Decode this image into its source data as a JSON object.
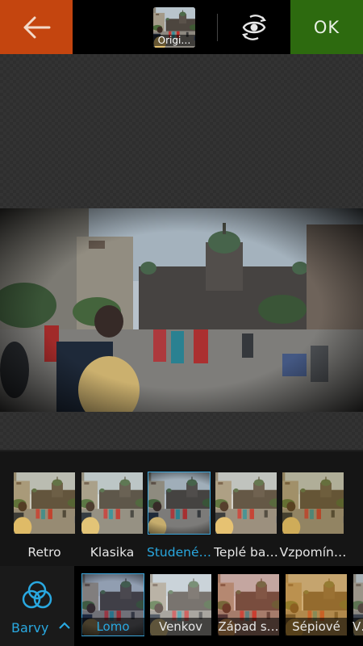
{
  "toolbar": {
    "back_icon": "arrow-left-icon",
    "original_label": "Origi…",
    "compare_icon": "compare-toggle-icon",
    "ok_label": "OK",
    "colors": {
      "back": "#c4450f",
      "ok": "#2d6a0f",
      "accent": "#29a8e0"
    }
  },
  "collapse_icon": "chevron-down-icon",
  "filters": [
    {
      "label": "Retro",
      "selected": false
    },
    {
      "label": "Klasika",
      "selected": false
    },
    {
      "label": "Studené…",
      "selected": true
    },
    {
      "label": "Teplé ba…",
      "selected": false
    },
    {
      "label": "Vzpomín…",
      "selected": false
    }
  ],
  "category": {
    "label": "Barvy",
    "icon": "color-circles-icon",
    "caret_icon": "chevron-up-icon"
  },
  "sub_filters": [
    {
      "label": "Lomo",
      "selected": true
    },
    {
      "label": "Venkov",
      "selected": false
    },
    {
      "label": "Západ s…",
      "selected": false
    },
    {
      "label": "Sépiové",
      "selected": false
    },
    {
      "label": "V…",
      "selected": false
    }
  ]
}
